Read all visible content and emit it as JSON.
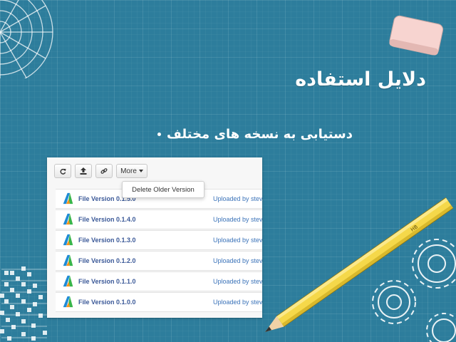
{
  "slide": {
    "title": "دلایل استفاده",
    "bullet": "دستیابی به نسخه های مختلف"
  },
  "toolbar": {
    "refresh_icon": "refresh-icon",
    "upload_icon": "upload-icon",
    "link_icon": "link-icon",
    "more_label": "More"
  },
  "dropdown": {
    "item": "Delete Older Version"
  },
  "files": [
    {
      "name": "File Version 0.1.5.0",
      "uploaded": "Uploaded by stev"
    },
    {
      "name": "File Version 0.1.4.0",
      "uploaded": "Uploaded by stev"
    },
    {
      "name": "File Version 0.1.3.0",
      "uploaded": "Uploaded by stev"
    },
    {
      "name": "File Version 0.1.2.0",
      "uploaded": "Uploaded by stev"
    },
    {
      "name": "File Version 0.1.1.0",
      "uploaded": "Uploaded by stev"
    },
    {
      "name": "File Version 0.1.0.0",
      "uploaded": "Uploaded by stev"
    }
  ],
  "pencil_label": "HB",
  "colors": {
    "background": "#2d7d9c",
    "link": "#3b5998",
    "pencil": "#f5d84a",
    "eraser": "#f7d4d0"
  }
}
